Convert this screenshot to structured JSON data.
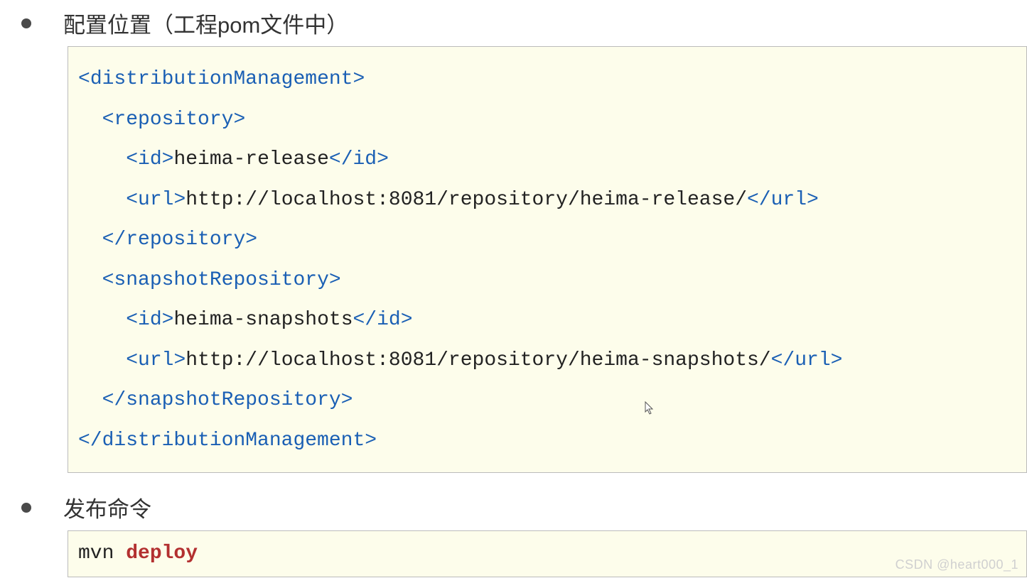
{
  "heading1": "配置位置（工程pom文件中）",
  "heading2": "发布命令",
  "xml": {
    "dm_open": "distributionManagement",
    "repo_open": "repository",
    "id_tag": "id",
    "url_tag": "url",
    "repo_id": "heima-release",
    "repo_url": "http://localhost:8081/repository/heima-release/",
    "snap_open": "snapshotRepository",
    "snap_id": "heima-snapshots",
    "snap_url": "http://localhost:8081/repository/heima-snapshots/"
  },
  "cmd": {
    "prefix": "mvn ",
    "keyword": "deploy"
  },
  "watermark": "CSDN @heart000_1"
}
